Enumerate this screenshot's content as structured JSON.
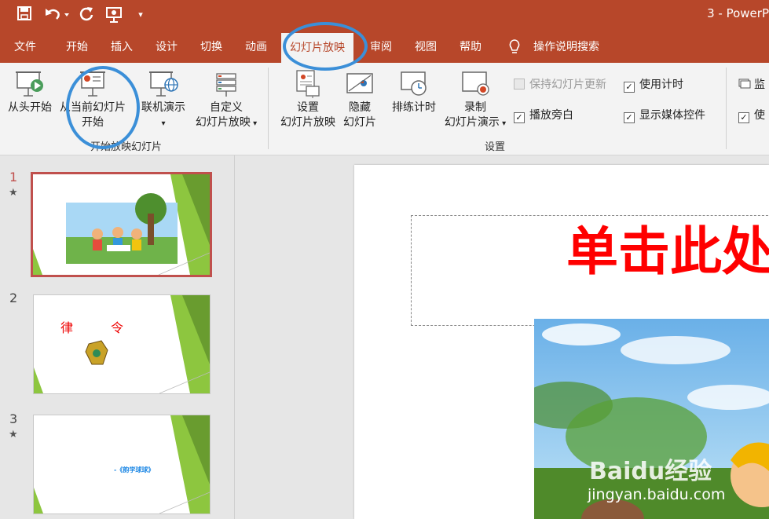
{
  "app_title": "3 - PowerP",
  "quick_access": [
    "save-icon",
    "undo-icon",
    "redo-icon",
    "present-icon",
    "customize-icon"
  ],
  "tabs": [
    "文件",
    "开始",
    "插入",
    "设计",
    "切换",
    "动画",
    "幻灯片放映",
    "审阅",
    "视图",
    "帮助"
  ],
  "active_tab": "幻灯片放映",
  "tell_me": "操作说明搜索",
  "ribbon": {
    "start_group": {
      "label": "开始放映幻灯片",
      "from_beginning": "从头开始",
      "from_current_1": "从当前幻灯片",
      "from_current_2": "开始",
      "online_present": "联机演示",
      "custom_show_1": "自定义",
      "custom_show_2": "幻灯片放映"
    },
    "setup_group": {
      "label": "设置",
      "setup_1": "设置",
      "setup_2": "幻灯片放映",
      "hide_1": "隐藏",
      "hide_2": "幻灯片",
      "rehearse": "排练计时",
      "record_1": "录制",
      "record_2": "幻灯片演示",
      "keep_updated": "保持幻灯片更新",
      "play_narrations": "播放旁白",
      "use_timings": "使用计时",
      "show_media_controls": "显示媒体控件"
    },
    "monitor_group": {
      "monitor_label": "监",
      "use_label": "使"
    }
  },
  "thumbnails": [
    {
      "num": "1",
      "starred": true,
      "selected": true
    },
    {
      "num": "2",
      "starred": false,
      "selected": false,
      "text": "律　　　令"
    },
    {
      "num": "3",
      "starred": true,
      "selected": false,
      "text": "-《韵学球球》"
    }
  ],
  "star_glyph": "★",
  "slide_title": "单击此处",
  "watermark": "Baidu经验",
  "watermark_url": "jingyan.baidu.com",
  "colors": {
    "accent": "#b7472a",
    "selection": "#c0504d",
    "annotation": "#3b8fd8",
    "title_red": "#ff0000",
    "slide_green": "#8dc63f"
  }
}
